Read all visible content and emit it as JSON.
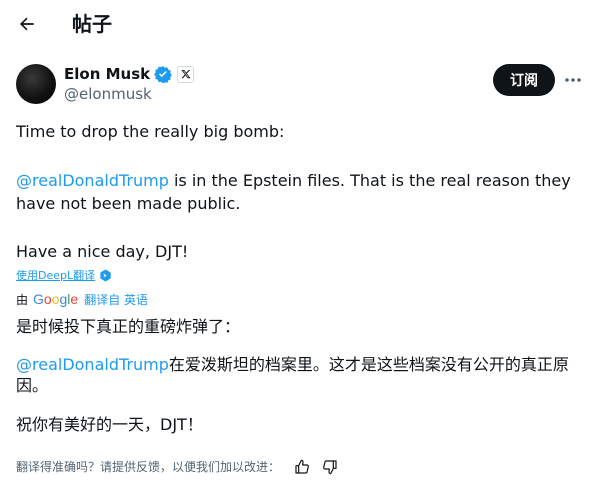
{
  "header": {
    "back_icon": "arrow-left-icon",
    "title": "帖子"
  },
  "author": {
    "display_name": "Elon Musk",
    "handle": "@elonmusk",
    "verified_icon": "verified-badge-icon",
    "affiliation_icon": "x-logo-icon",
    "subscribe_label": "订阅",
    "more_icon": "more-horizontal-icon"
  },
  "tweet": {
    "line1": "Time to drop the really big bomb:",
    "mention": "@realDonaldTrump",
    "line2_rest": " is in the Epstein files. That is the real reason they have not been made public.",
    "line3": "Have a nice day, DJT!"
  },
  "translation": {
    "deepl_link": "使用DeepL翻译",
    "by_label": "由",
    "google_logo": "Google",
    "translated_from": "翻译自 英语",
    "zh_line1": "是时候投下真正的重磅炸弹了：",
    "zh_mention": "@realDonaldTrump",
    "zh_line2_rest": "在爱泼斯坦的档案里。这才是这些档案没有公开的真正原因。",
    "zh_line3": "祝你有美好的一天，DJT！"
  },
  "feedback": {
    "question": "翻译得准确吗？请提供反馈，以便我们加以改进：",
    "thumbs_up_icon": "thumbs-up-icon",
    "thumbs_down_icon": "thumbs-down-icon"
  },
  "colors": {
    "accent": "#1d9bf0",
    "text": "#0f1419",
    "muted": "#536471",
    "button_bg": "#0f1419"
  }
}
